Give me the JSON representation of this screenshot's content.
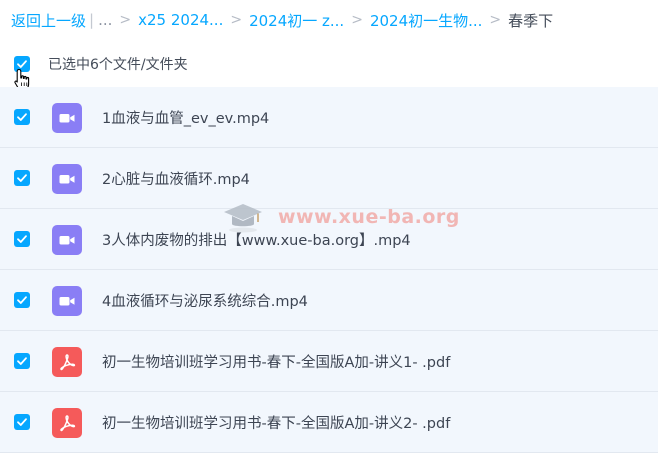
{
  "breadcrumb": {
    "back": "返回上一级",
    "more": "...",
    "items": [
      "x25 2024...",
      "2024初一 z...",
      "2024初一生物..."
    ],
    "current": "春季下"
  },
  "selection": {
    "text": "已选中6个文件/文件夹"
  },
  "files": [
    {
      "name": "1血液与血管_ev_ev.mp4",
      "type": "video",
      "checked": true
    },
    {
      "name": "2心脏与血液循环.mp4",
      "type": "video",
      "checked": true
    },
    {
      "name": "3人体内废物的排出【www.xue-ba.org】.mp4",
      "type": "video",
      "checked": true
    },
    {
      "name": "4血液循环与泌尿系统综合.mp4",
      "type": "video",
      "checked": true
    },
    {
      "name": "初一生物培训班学习用书-春下-全国版A加-讲义1- .pdf",
      "type": "pdf",
      "checked": true
    },
    {
      "name": "初一生物培训班学习用书-春下-全国版A加-讲义2- .pdf",
      "type": "pdf",
      "checked": true
    }
  ],
  "watermark": "www.xue-ba.org",
  "colors": {
    "accent": "#06a7ff",
    "video_icon": "#8a7ef5",
    "pdf_icon": "#f55a5a",
    "row_background": "#f2f7fd"
  }
}
